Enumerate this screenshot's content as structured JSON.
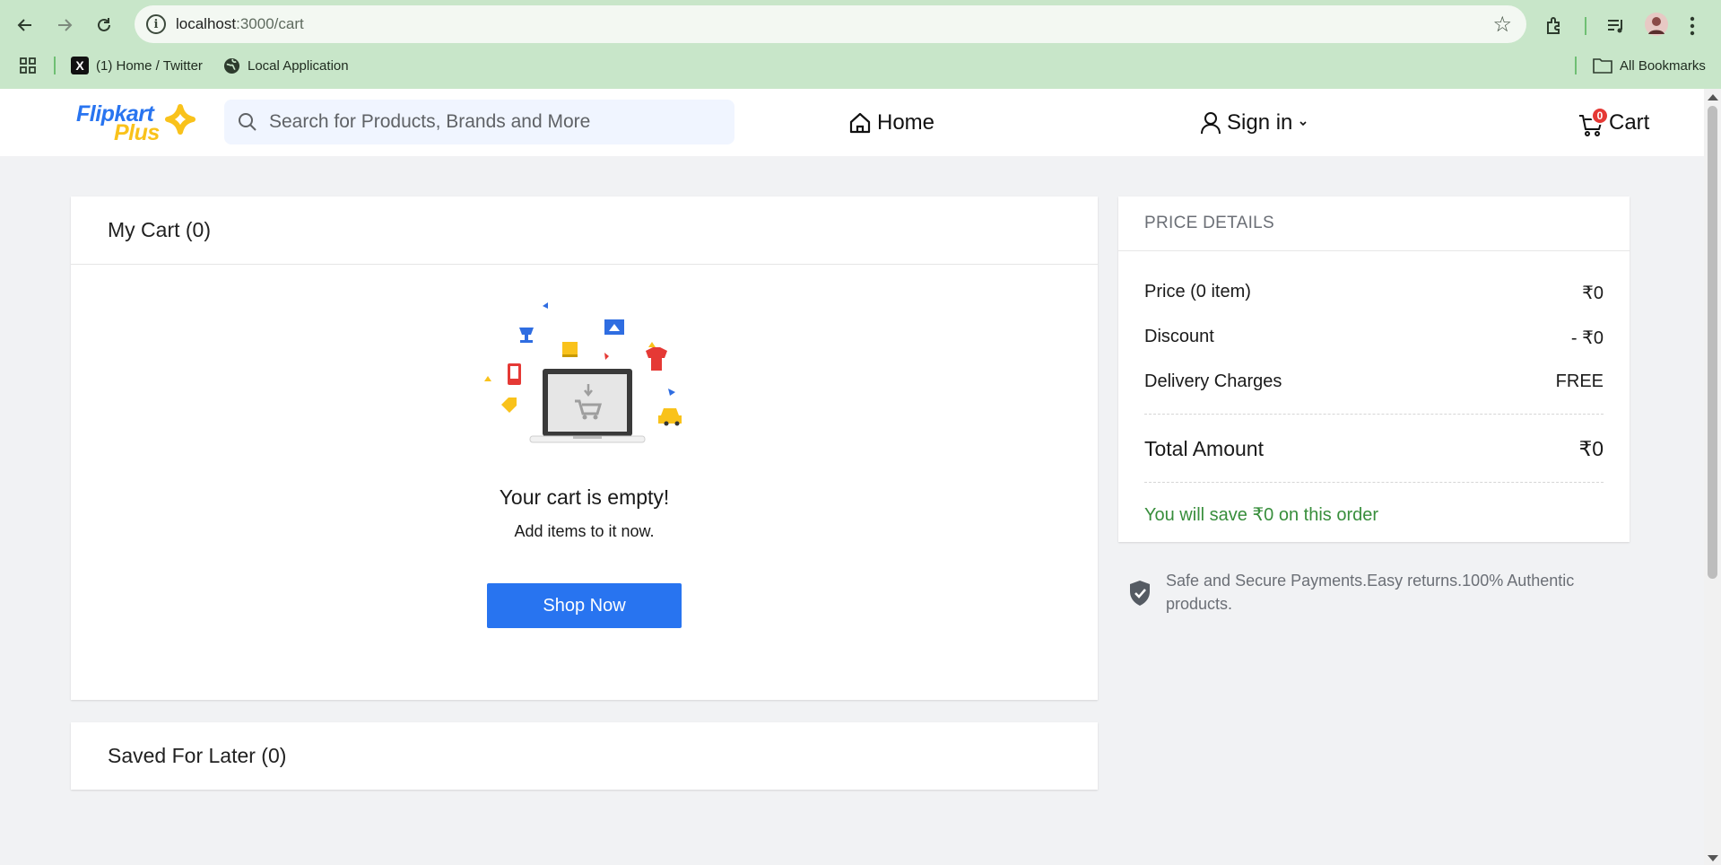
{
  "browser": {
    "url_host": "localhost",
    "url_path": ":3000/cart",
    "bookmarks": [
      {
        "label": "(1) Home / Twitter",
        "icon": "x-logo-icon"
      },
      {
        "label": "Local Application",
        "icon": "globe-icon"
      }
    ],
    "all_bookmarks_label": "All Bookmarks"
  },
  "header": {
    "logo_line1": "Flipkart",
    "logo_line2": "Plus",
    "search_placeholder": "Search for Products, Brands and More",
    "home_label": "Home",
    "signin_label": "Sign in",
    "cart_label": "Cart",
    "cart_count": "0"
  },
  "cart": {
    "title": "My Cart (0)",
    "empty_title": "Your cart is empty!",
    "empty_sub": "Add items to it now.",
    "shop_now_label": "Shop Now"
  },
  "saved": {
    "title": "Saved For Later (0)"
  },
  "price_details": {
    "heading": "PRICE DETAILS",
    "rows": [
      {
        "label": "Price (0 item)",
        "value": "₹0"
      },
      {
        "label": "Discount",
        "value": "- ₹0"
      },
      {
        "label": "Delivery Charges",
        "value": "FREE"
      }
    ],
    "total_label": "Total Amount",
    "total_value": "₹0",
    "save_text": "You will save ₹0 on this order"
  },
  "secure_text": "Safe and Secure Payments.Easy returns.100% Authentic products.",
  "colors": {
    "brand_blue": "#2874f0",
    "brand_yellow": "#f9c21b",
    "save_green": "#388e3c",
    "badge_red": "#e53935",
    "chrome_green": "#c8e6c9"
  }
}
